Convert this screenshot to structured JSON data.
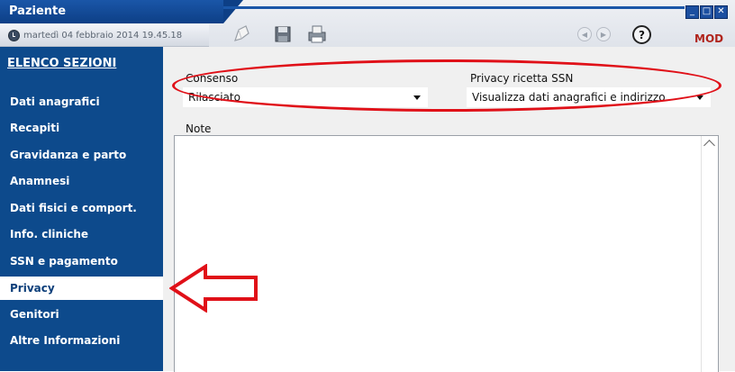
{
  "window": {
    "title": "Paziente",
    "datetime": "martedì 04 febbraio 2014  19.45.18",
    "mode": "MOD",
    "controls": [
      "minimize",
      "maximize",
      "close"
    ]
  },
  "toolbar": {
    "icons": [
      "edit-pen-icon",
      "save-disk-icon",
      "print-icon"
    ],
    "nav": [
      "previous-icon",
      "next-icon"
    ],
    "help_label": "?"
  },
  "sidebar": {
    "title": "ELENCO SEZIONI",
    "items": [
      {
        "label": "Dati anagrafici"
      },
      {
        "label": "Recapiti"
      },
      {
        "label": "Gravidanza e parto"
      },
      {
        "label": "Anamnesi"
      },
      {
        "label": "Dati fisici e comport."
      },
      {
        "label": "Info. cliniche"
      },
      {
        "label": "SSN e pagamento"
      },
      {
        "label": "Privacy",
        "active": true
      },
      {
        "label": "Genitori"
      },
      {
        "label": "Altre Informazioni"
      }
    ]
  },
  "form": {
    "consenso": {
      "label": "Consenso",
      "value": "Rilasciato"
    },
    "privacy_ricetta": {
      "label": "Privacy ricetta SSN",
      "value": "Visualizza dati anagrafici e indirizzo"
    },
    "note": {
      "label": "Note",
      "value": ""
    }
  },
  "colors": {
    "sidebar_bg": "#0d4a8c",
    "title_bg": "#1a56a8",
    "highlight_red": "#e01018",
    "mod_red": "#b0241c"
  }
}
